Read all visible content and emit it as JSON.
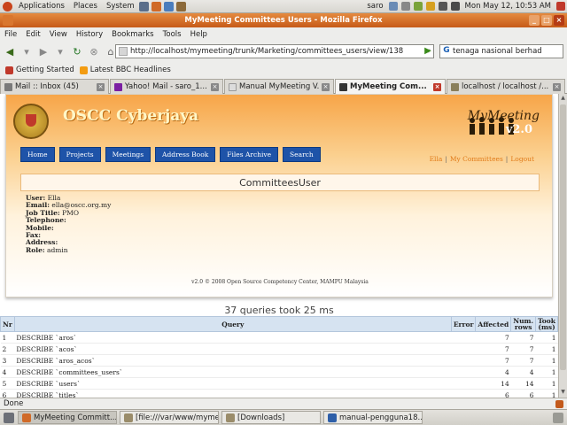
{
  "panel": {
    "menus": [
      "Applications",
      "Places",
      "System"
    ],
    "user": "saro",
    "clock": "Mon May 12, 10:53 AM"
  },
  "window": {
    "title": "MyMeeting Committees Users - Mozilla Firefox"
  },
  "menubar": [
    "File",
    "Edit",
    "View",
    "History",
    "Bookmarks",
    "Tools",
    "Help"
  ],
  "navbar": {
    "url": "http://localhost/mymeeting/trunk/Marketing/committees_users/view/138",
    "search_value": "tenaga nasional berhad"
  },
  "bookmarks": [
    "Getting Started",
    "Latest BBC Headlines"
  ],
  "tabs": [
    {
      "label": "Mail :: Inbox (45)",
      "active": false
    },
    {
      "label": "Yahoo! Mail - saro_1...",
      "active": false
    },
    {
      "label": "Manual MyMeeting V...",
      "active": false
    },
    {
      "label": "MyMeeting Com...",
      "active": true
    },
    {
      "label": "localhost / localhost /...",
      "active": false
    }
  ],
  "site": {
    "title": "OSCC Cyberjaya",
    "logo_text": "MyMeeting",
    "logo_version": "v2.0",
    "nav": [
      "Home",
      "Projects",
      "Meetings",
      "Address Book",
      "Files Archive",
      "Search"
    ],
    "user_links": [
      "Ella",
      "My Committees",
      "Logout"
    ],
    "heading": "CommitteesUser",
    "fields": [
      {
        "label": "User:",
        "value": "Ella"
      },
      {
        "label": "Email:",
        "value": "ella@oscc.org.my"
      },
      {
        "label": "Job Title:",
        "value": "PMO"
      },
      {
        "label": "Telephone:",
        "value": ""
      },
      {
        "label": "Mobile:",
        "value": ""
      },
      {
        "label": "Fax:",
        "value": ""
      },
      {
        "label": "Address:",
        "value": ""
      },
      {
        "label": "Role:",
        "value": "admin"
      }
    ],
    "footer": "v2.0 © 2008 Open Source Competency Center, MAMPU Malaysia"
  },
  "sql": {
    "summary": "37 queries took 25 ms",
    "headers": [
      "Nr",
      "Query",
      "Error",
      "Affected",
      "Num. rows",
      "Took (ms)"
    ],
    "rows": [
      {
        "nr": "1",
        "query": "DESCRIBE `aros`",
        "error": "",
        "affected": "7",
        "rows": "7",
        "took": "1"
      },
      {
        "nr": "2",
        "query": "DESCRIBE `acos`",
        "error": "",
        "affected": "7",
        "rows": "7",
        "took": "1"
      },
      {
        "nr": "3",
        "query": "DESCRIBE `aros_acos`",
        "error": "",
        "affected": "7",
        "rows": "7",
        "took": "1"
      },
      {
        "nr": "4",
        "query": "DESCRIBE `committees_users`",
        "error": "",
        "affected": "4",
        "rows": "4",
        "took": "1"
      },
      {
        "nr": "5",
        "query": "DESCRIBE `users`",
        "error": "",
        "affected": "14",
        "rows": "14",
        "took": "1"
      },
      {
        "nr": "6",
        "query": "DESCRIBE `titles`",
        "error": "",
        "affected": "6",
        "rows": "6",
        "took": "1"
      }
    ]
  },
  "status": "Done",
  "taskbar": [
    {
      "label": "MyMeeting Committ...",
      "active": true
    },
    {
      "label": "[file:///var/www/myme...",
      "active": false
    },
    {
      "label": "[Downloads]",
      "active": false
    },
    {
      "label": "manual-pengguna18...",
      "active": false
    }
  ],
  "colors": {
    "panel_bg": "#dcdad5",
    "titlebar": "#d9772f",
    "header_orange": "#f7a548",
    "nav_blue": "#1e53a8",
    "table_header": "#d6e3f1"
  }
}
